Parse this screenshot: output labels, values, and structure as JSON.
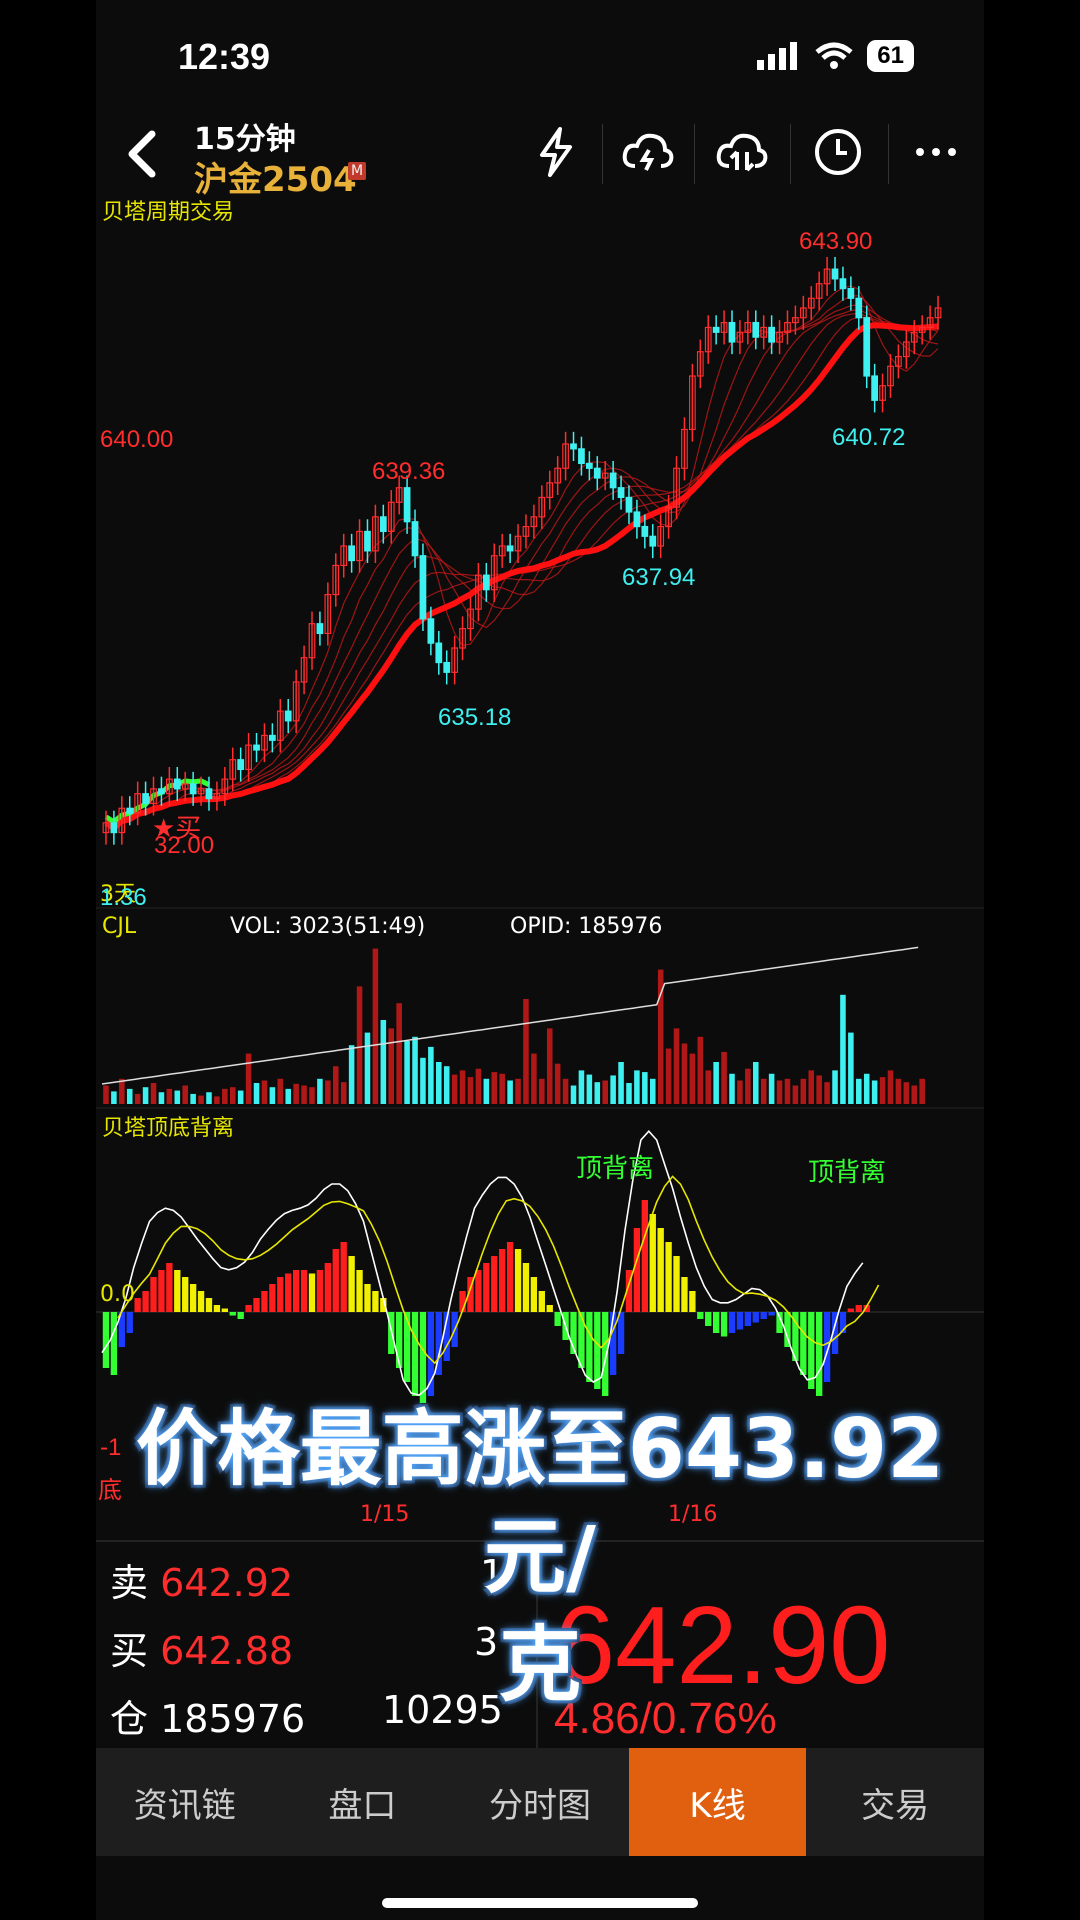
{
  "status_bar": {
    "time": "12:39",
    "battery": "61"
  },
  "nav": {
    "subtitle": "15分钟",
    "title": "沪金2504",
    "badge": "M"
  },
  "main_chart": {
    "indicator_label": "贝塔周期交易",
    "price_left": "640.00",
    "high_label": "643.90",
    "labels": [
      "639.36",
      "637.94",
      "635.18",
      "640.72"
    ],
    "low_label": "32.00",
    "buy_marker": "★买",
    "left_bottom_1": "3天",
    "left_bottom_2": "1.36"
  },
  "volume_panel": {
    "name": "CJL",
    "vol": "VOL: 3023(51:49)",
    "opid": "OPID: 185976"
  },
  "osc_panel": {
    "name": "贝塔顶底背离",
    "zero": "0.0",
    "div1": "顶背离",
    "div2": "顶背离",
    "neg": "-1",
    "bottom": "底"
  },
  "dates": [
    "1/15",
    "1/16"
  ],
  "subtitle": {
    "line1": "价格最高涨至643.92元/",
    "line2": "克"
  },
  "quote": {
    "sell_label": "卖",
    "sell_price": "642.92",
    "sell_qty": "1",
    "buy_label": "买",
    "buy_price": "642.88",
    "buy_qty": "3",
    "oi_label": "仓",
    "oi_value": "185976",
    "oi_change": "10295",
    "last_price": "642.90",
    "change": "4.86/0.76%"
  },
  "tabs": [
    "资讯链",
    "盘口",
    "分时图",
    "K线",
    "交易"
  ],
  "active_tab": "K线",
  "colors": {
    "up": "#ff2d2d",
    "down": "#3ff0f0",
    "accent": "#e0600f",
    "title_gold": "#e8b13a"
  },
  "chart_data": {
    "type": "candlestick",
    "price_range": [
      631,
      645
    ],
    "highs_lows_labeled": {
      "high": 643.9,
      "lows": [
        635.18,
        637.94,
        640.72
      ],
      "mid_high": 639.36
    },
    "closes": [
      632.3,
      632.1,
      632.6,
      632.5,
      632.9,
      632.7,
      633.0,
      632.9,
      633.2,
      633.0,
      633.1,
      632.9,
      633.0,
      632.8,
      632.9,
      633.2,
      633.6,
      633.4,
      633.9,
      633.8,
      634.1,
      634.0,
      634.6,
      634.4,
      635.2,
      635.7,
      636.4,
      636.2,
      637.0,
      637.6,
      638.0,
      637.7,
      638.3,
      637.9,
      638.6,
      638.3,
      638.9,
      639.2,
      638.5,
      637.8,
      636.5,
      636.0,
      635.6,
      635.4,
      635.9,
      636.3,
      636.7,
      637.4,
      637.1,
      637.8,
      638.0,
      637.9,
      638.2,
      638.4,
      638.6,
      639.0,
      639.3,
      639.6,
      640.1,
      640.0,
      639.7,
      639.6,
      639.4,
      639.5,
      639.2,
      639.0,
      638.7,
      638.4,
      638.2,
      638.0,
      638.4,
      638.8,
      639.6,
      640.4,
      641.5,
      642.0,
      642.5,
      642.4,
      642.6,
      642.2,
      642.4,
      642.6,
      642.3,
      642.5,
      642.2,
      642.4,
      642.6,
      642.7,
      642.9,
      643.1,
      643.4,
      643.7,
      643.5,
      643.3,
      643.1,
      642.7,
      641.5,
      641.0,
      641.3,
      641.7,
      641.9,
      642.2,
      642.4,
      642.5,
      642.7,
      642.9
    ],
    "volume": [
      22,
      15,
      30,
      18,
      12,
      20,
      25,
      14,
      18,
      16,
      22,
      12,
      10,
      14,
      9,
      18,
      20,
      16,
      60,
      25,
      28,
      20,
      30,
      18,
      24,
      22,
      20,
      30,
      28,
      45,
      26,
      70,
      140,
      85,
      185,
      100,
      90,
      120,
      75,
      80,
      55,
      68,
      50,
      45,
      35,
      40,
      32,
      42,
      30,
      38,
      36,
      28,
      30,
      125,
      60,
      30,
      90,
      48,
      30,
      22,
      40,
      35,
      26,
      28,
      34,
      50,
      25,
      40,
      38,
      30,
      160,
      66,
      90,
      72,
      60,
      80,
      40,
      50,
      62,
      36,
      28,
      42,
      50,
      30,
      36,
      28,
      30,
      22,
      30,
      40,
      34,
      26,
      40,
      130,
      85,
      30,
      36,
      28,
      32,
      40,
      30,
      26,
      22,
      30
    ],
    "oscillator_bars": [
      -0.8,
      -0.9,
      -0.5,
      -0.3,
      0.2,
      0.3,
      0.5,
      0.6,
      0.7,
      0.6,
      0.5,
      0.4,
      0.3,
      0.2,
      0.1,
      0.05,
      -0.05,
      -0.1,
      0.1,
      0.2,
      0.3,
      0.4,
      0.5,
      0.55,
      0.6,
      0.6,
      0.55,
      0.6,
      0.7,
      0.9,
      1.0,
      0.8,
      0.6,
      0.4,
      0.3,
      0.2,
      -0.6,
      -0.8,
      -1.0,
      -1.2,
      -1.3,
      -1.2,
      -0.9,
      -0.7,
      -0.5,
      0.3,
      0.5,
      0.6,
      0.7,
      0.8,
      0.9,
      1.0,
      0.9,
      0.7,
      0.5,
      0.3,
      0.1,
      -0.2,
      -0.4,
      -0.6,
      -0.8,
      -1.0,
      -1.1,
      -1.2,
      -0.9,
      -0.6,
      0.6,
      1.2,
      1.6,
      1.4,
      1.2,
      1.0,
      0.8,
      0.5,
      0.3,
      -0.1,
      -0.2,
      -0.3,
      -0.35,
      -0.3,
      -0.25,
      -0.2,
      -0.15,
      -0.1,
      -0.05,
      -0.3,
      -0.5,
      -0.7,
      -0.9,
      -1.1,
      -1.2,
      -1.0,
      -0.6,
      -0.3,
      0.05,
      0.1,
      0.1
    ]
  }
}
